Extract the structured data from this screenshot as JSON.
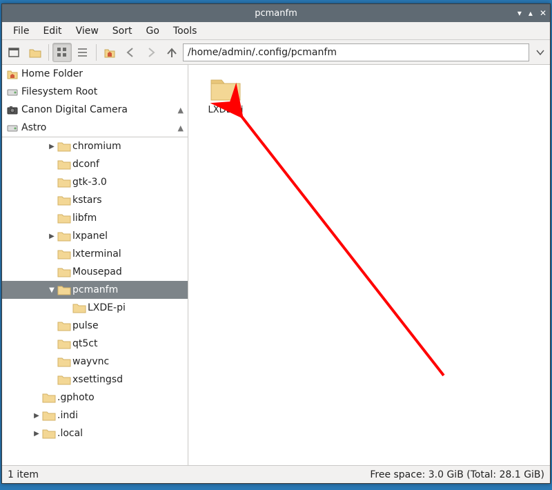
{
  "window": {
    "title": "pcmanfm"
  },
  "menubar": [
    "File",
    "Edit",
    "View",
    "Sort",
    "Go",
    "Tools"
  ],
  "toolbar": {
    "buttons": {
      "new_tab": "new-tab-icon",
      "new_folder": "folder-icon",
      "iconview": "icon-view-icon",
      "listview": "list-view-icon",
      "home": "home-icon"
    }
  },
  "address": {
    "path": "/home/admin/.config/pcmanfm"
  },
  "places": [
    {
      "icon": "home-icon",
      "label": "Home Folder"
    },
    {
      "icon": "drive-icon",
      "label": "Filesystem Root"
    },
    {
      "icon": "camera-icon",
      "label": "Canon Digital Camera",
      "ejectable": true
    },
    {
      "icon": "drive-icon",
      "label": "Astro",
      "ejectable": true
    }
  ],
  "tree": [
    {
      "indent": 3,
      "expander": "right",
      "label": "chromium"
    },
    {
      "indent": 3,
      "expander": "",
      "label": "dconf"
    },
    {
      "indent": 3,
      "expander": "",
      "label": "gtk-3.0"
    },
    {
      "indent": 3,
      "expander": "",
      "label": "kstars"
    },
    {
      "indent": 3,
      "expander": "",
      "label": "libfm"
    },
    {
      "indent": 3,
      "expander": "right",
      "label": "lxpanel"
    },
    {
      "indent": 3,
      "expander": "",
      "label": "lxterminal"
    },
    {
      "indent": 3,
      "expander": "",
      "label": "Mousepad"
    },
    {
      "indent": 3,
      "expander": "down",
      "label": "pcmanfm",
      "selected": true
    },
    {
      "indent": 4,
      "expander": "",
      "label": "LXDE-pi"
    },
    {
      "indent": 3,
      "expander": "",
      "label": "pulse"
    },
    {
      "indent": 3,
      "expander": "",
      "label": "qt5ct"
    },
    {
      "indent": 3,
      "expander": "",
      "label": "wayvnc"
    },
    {
      "indent": 3,
      "expander": "",
      "label": "xsettingsd"
    },
    {
      "indent": 2,
      "expander": "",
      "label": ".gphoto"
    },
    {
      "indent": 2,
      "expander": "right",
      "label": ".indi"
    },
    {
      "indent": 2,
      "expander": "right",
      "label": ".local"
    }
  ],
  "content": {
    "items": [
      {
        "label": "LXDE-pi"
      }
    ]
  },
  "statusbar": {
    "left": "1 item",
    "right": "Free space: 3.0 GiB (Total: 28.1 GiB)"
  }
}
